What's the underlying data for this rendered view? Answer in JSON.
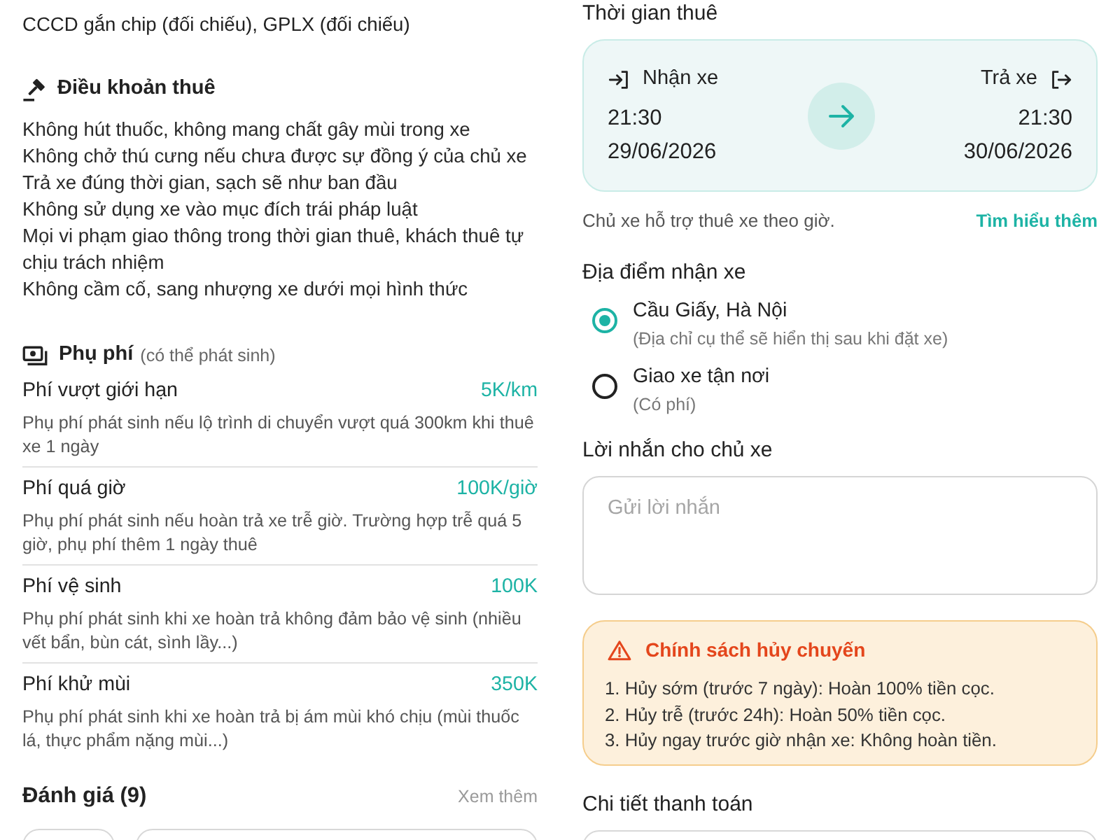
{
  "left": {
    "documents_note": "CCCD gắn chip (đối chiếu), GPLX (đối chiếu)",
    "rental_terms": {
      "title": "Điều khoản thuê",
      "items": [
        "Không hút thuốc, không mang chất gây mùi trong xe",
        "Không chở thú cưng nếu chưa được sự đồng ý của chủ xe",
        "Trả xe đúng thời gian, sạch sẽ như ban đầu",
        "Không sử dụng xe vào mục đích trái pháp luật",
        "Mọi vi phạm giao thông trong thời gian thuê, khách thuê tự chịu trách nhiệm",
        "Không cầm cố, sang nhượng xe dưới mọi hình thức"
      ]
    },
    "surcharges": {
      "title": "Phụ phí",
      "subtitle": "(có thể phát sinh)",
      "items": [
        {
          "name": "Phí vượt giới hạn",
          "price": "5K/km",
          "description": "Phụ phí phát sinh nếu lộ trình di chuyển vượt quá 300km khi thuê xe 1 ngày"
        },
        {
          "name": "Phí quá giờ",
          "price": "100K/giờ",
          "description": "Phụ phí phát sinh nếu hoàn trả xe trễ giờ. Trường hợp trễ quá 5 giờ, phụ phí thêm 1 ngày thuê"
        },
        {
          "name": "Phí vệ sinh",
          "price": "100K",
          "description": "Phụ phí phát sinh khi xe hoàn trả không đảm bảo vệ sinh (nhiều vết bẩn, bùn cát, sình lầy...)"
        },
        {
          "name": "Phí khử mùi",
          "price": "350K",
          "description": "Phụ phí phát sinh khi xe hoàn trả bị ám mùi khó chịu (mùi thuốc lá, thực phẩm nặng mùi...)"
        }
      ]
    },
    "reviews": {
      "title": "Đánh giá (9)",
      "link": "Xem thêm"
    }
  },
  "right": {
    "rental_time": {
      "title": "Thời gian thuê",
      "pickup": {
        "label": "Nhận xe",
        "time": "21:30",
        "date": "29/06/2026"
      },
      "return": {
        "label": "Trả xe",
        "time": "21:30",
        "date": "30/06/2026"
      },
      "note": "Chủ xe hỗ trợ thuê xe theo giờ.",
      "link": "Tìm hiểu thêm"
    },
    "pickup_location": {
      "title": "Địa điểm nhận xe",
      "options": [
        {
          "label": "Cầu Giấy, Hà Nội",
          "detail": "(Địa chỉ cụ thể sẽ hiển thị sau khi đặt xe)",
          "selected": true
        },
        {
          "label": "Giao xe tận nơi",
          "detail": "(Có phí)",
          "selected": false
        }
      ]
    },
    "message": {
      "title": "Lời nhắn cho chủ xe",
      "placeholder": "Gửi lời nhắn"
    },
    "cancellation_policy": {
      "title": "Chính sách hủy chuyến",
      "items": [
        "1. Hủy sớm (trước 7 ngày): Hoàn 100% tiền cọc.",
        "2. Hủy trễ (trước 24h): Hoàn 50% tiền cọc.",
        "3. Hủy ngay trước giờ nhận xe: Không hoàn tiền."
      ]
    },
    "payment_details": {
      "title": "Chi tiết thanh toán"
    }
  }
}
